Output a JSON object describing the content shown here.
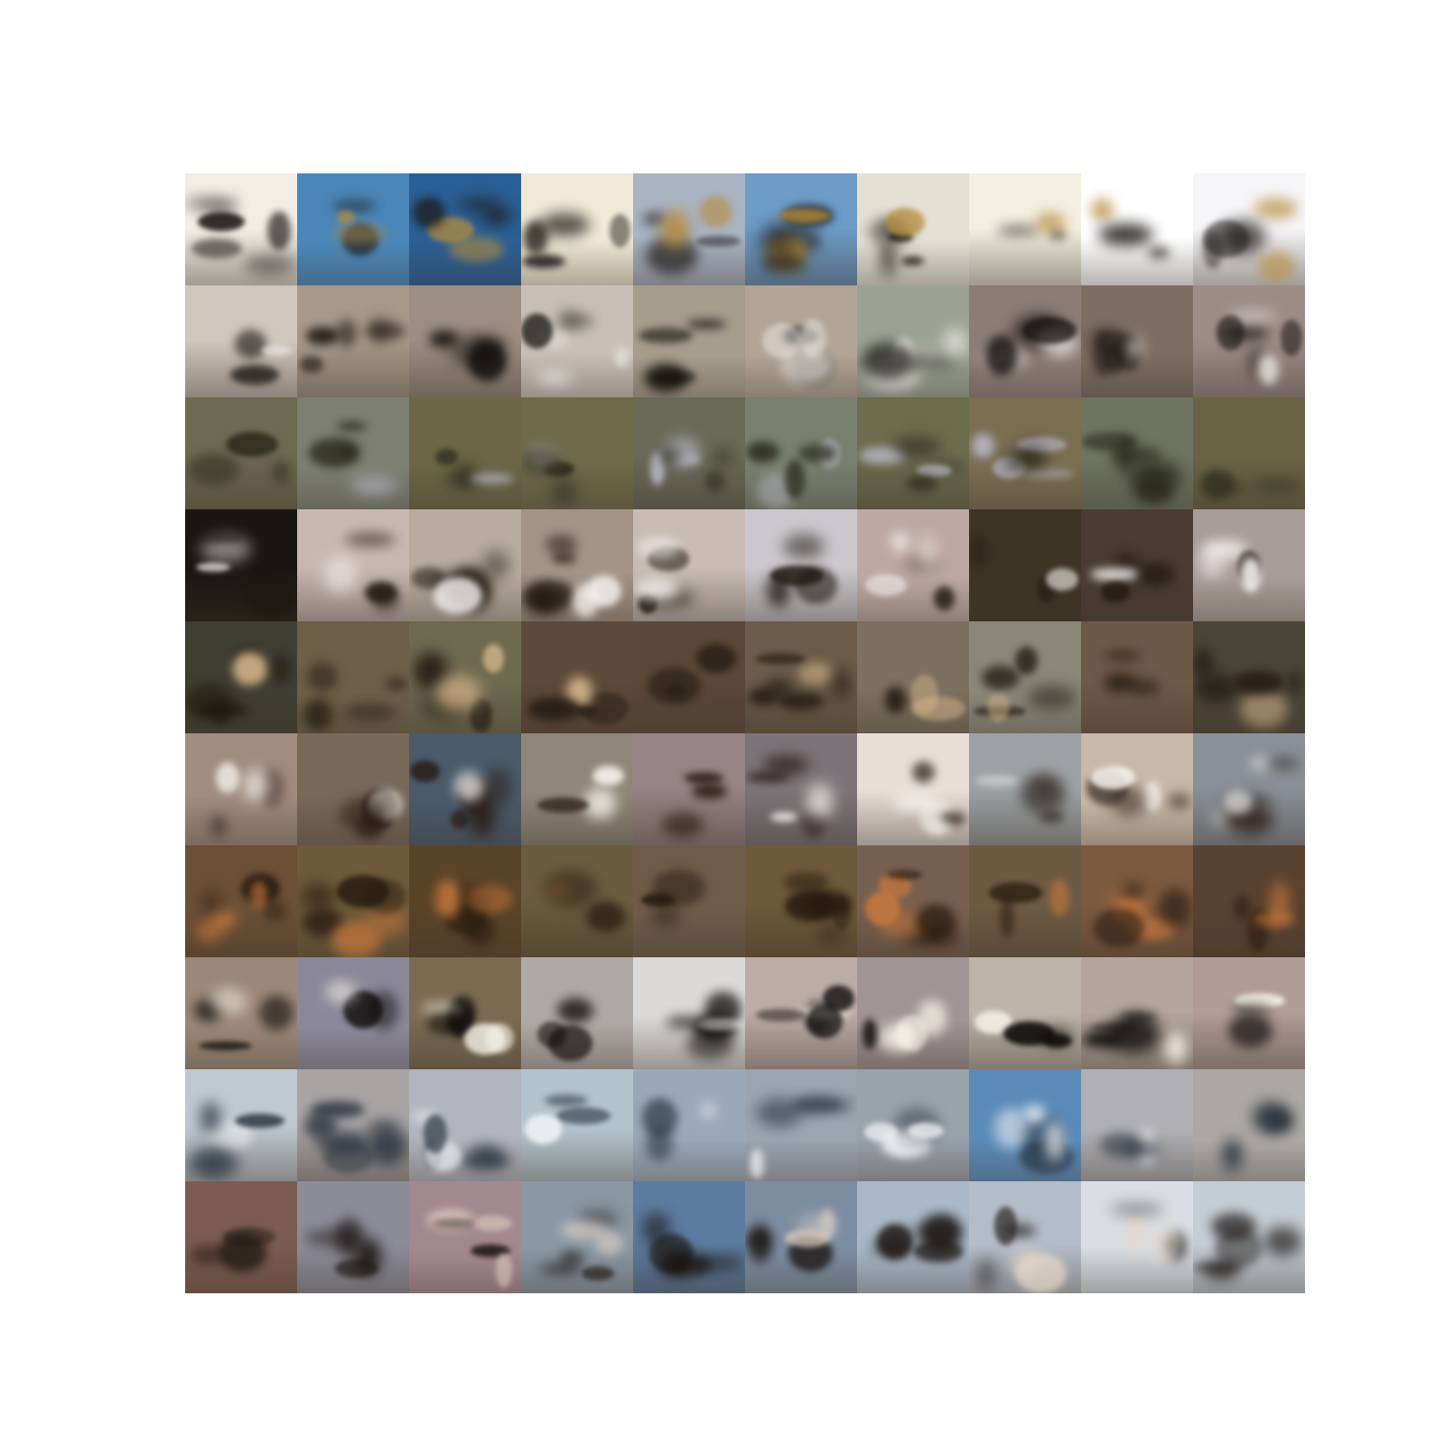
{
  "figure": {
    "grid_rows": 10,
    "grid_cols": 10,
    "row_palettes": [
      {
        "row": 0,
        "bg": [
          "#f2eee6",
          "#4a86b8",
          "#2a5f95",
          "#efe9d6",
          "#a9b3c2",
          "#6d9cc8",
          "#e4e0d4",
          "#f3efe2",
          "#ffffff",
          "#f6f5f8"
        ],
        "fg": "#1d1a17",
        "accent": "#b68c3c"
      },
      {
        "row": 1,
        "bg": [
          "#cfc6be",
          "#a8988a",
          "#9c8e84",
          "#c8c0b8",
          "#a69c8c",
          "#b2a496",
          "#9aa294",
          "#8c7c78",
          "#7c6c62",
          "#9c8c88"
        ],
        "fg": "#15120f",
        "accent": "#e8e4e0"
      },
      {
        "row": 2,
        "bg": [
          "#6f6a52",
          "#7c7f72",
          "#6b6747",
          "#6e6a4a",
          "#6a6a58",
          "#78806f",
          "#6c6c4e",
          "#7a6e52",
          "#6e7460",
          "#6a6446"
        ],
        "fg": "#2a2a1c",
        "accent": "#b9b9c8"
      },
      {
        "row": 3,
        "bg": [
          "#1a1612",
          "#c8b8b4",
          "#b8aca0",
          "#a49488",
          "#c8bcb4",
          "#cac8cc",
          "#bca8a4",
          "#3e3426",
          "#4a3c34",
          "#a89c98"
        ],
        "fg": "#201812",
        "accent": "#f4f0ee"
      },
      {
        "row": 4,
        "bg": [
          "#3e3e32",
          "#6c6048",
          "#6e6a50",
          "#5e4a3a",
          "#5a4838",
          "#6a5c48",
          "#7c7060",
          "#8a8678",
          "#6e5848",
          "#4a4436"
        ],
        "fg": "#221a12",
        "accent": "#d8b88c"
      },
      {
        "row": 5,
        "bg": [
          "#a08c80",
          "#786858",
          "#4a5a6a",
          "#8e8678",
          "#968484",
          "#7c7478",
          "#e8ded8",
          "#9ca2a4",
          "#c8b8a8",
          "#8a9098"
        ],
        "fg": "#2a1c16",
        "accent": "#f8f6f2"
      },
      {
        "row": 6,
        "bg": [
          "#6c5036",
          "#6e5a3a",
          "#5a4428",
          "#6a5c3e",
          "#6e5c48",
          "#6e5a3a",
          "#786050",
          "#6c5a42",
          "#7c5a40",
          "#5a4230"
        ],
        "fg": "#261a10",
        "accent": "#c8783c"
      },
      {
        "row": 7,
        "bg": [
          "#9c8878",
          "#8a8898",
          "#7a6a52",
          "#b0a8a4",
          "#dcdad8",
          "#bcaca8",
          "#a09494",
          "#bcb4a8",
          "#b4a69e",
          "#b09c98"
        ],
        "fg": "#0e0c0a",
        "accent": "#f8f4ea"
      },
      {
        "row": 8,
        "bg": [
          "#c0c8d0",
          "#a8a4a4",
          "#b0b4bc",
          "#b4c4cc",
          "#9aa8b8",
          "#9ca4b0",
          "#9aa2ac",
          "#5a8ab8",
          "#b0b0b4",
          "#aca8a4"
        ],
        "fg": "#2a3440",
        "accent": "#f2f4f6"
      },
      {
        "row": 9,
        "bg": [
          "#7c5c50",
          "#8c8c98",
          "#a48890",
          "#8a98a4",
          "#5c7ca0",
          "#7c8ca0",
          "#aab8c8",
          "#b4bcc8",
          "#d8dee4",
          "#c4ccd4"
        ],
        "fg": "#1a1410",
        "accent": "#e8d8c8"
      }
    ]
  }
}
